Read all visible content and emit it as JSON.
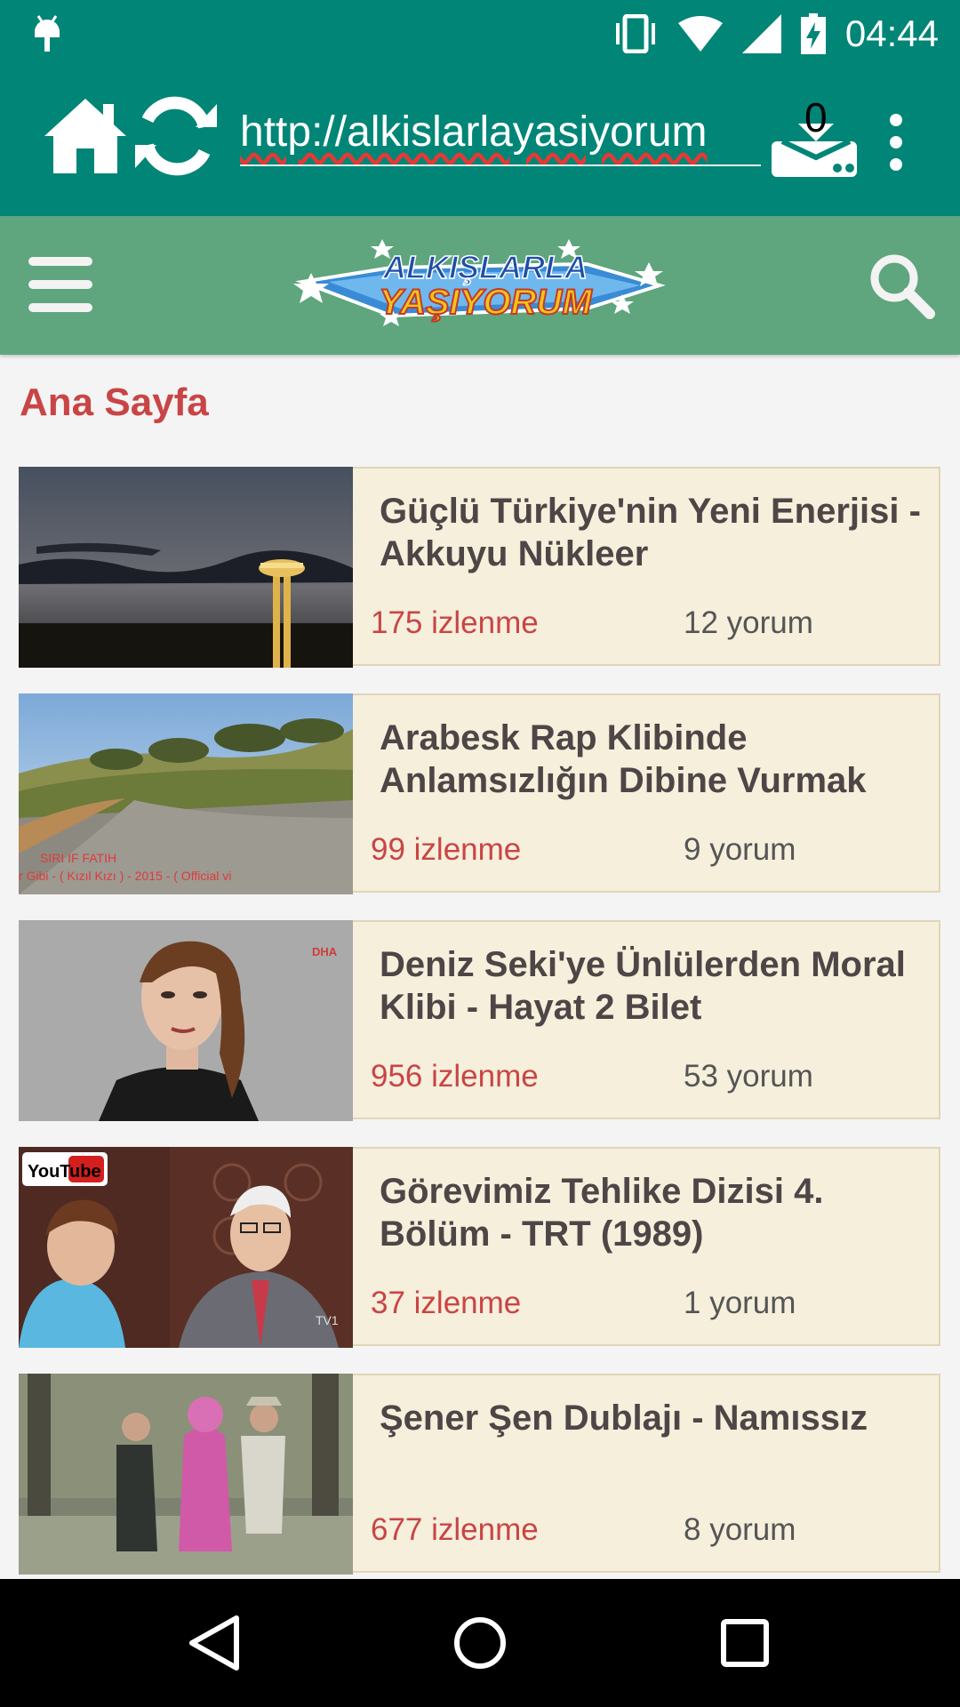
{
  "status_bar": {
    "time": "04:44",
    "icons": [
      "android-debug-icon",
      "vibrate-icon",
      "wifi-icon",
      "signal-icon",
      "battery-charging-icon"
    ]
  },
  "browser": {
    "url": "http://alkislarlayasiyorum",
    "download_count": "0",
    "icons": [
      "home-icon",
      "reload-icon",
      "download-icon",
      "overflow-menu-icon"
    ]
  },
  "site": {
    "logo_text_line1": "ALKIŞLARLA",
    "logo_text_line2": "YAŞIYORUM",
    "icons": [
      "hamburger-menu-icon",
      "search-icon"
    ]
  },
  "page": {
    "title": "Ana Sayfa"
  },
  "videos": [
    {
      "title": "Güçlü Türkiye'nin Yeni Enerjisi - Akkuyu Nükleer",
      "views": "175 izlenme",
      "comments": "12 yorum"
    },
    {
      "title": "Arabesk Rap Klibinde Anlamsızlığın Dibine Vurmak",
      "views": "99 izlenme",
      "comments": "9 yorum",
      "thumb_caption_1": "SIRI IF FATIH",
      "thumb_caption_2": "r Gibi - ( Kızıl Kızı ) - 2015 - ( Official vi"
    },
    {
      "title": "Deniz Seki'ye Ünlülerden Moral Klibi - Hayat 2 Bilet",
      "views": "956 izlenme",
      "comments": "53 yorum",
      "thumb_caption_1": "DHA"
    },
    {
      "title": "Görevimiz Tehlike Dizisi 4. Bölüm - TRT (1989)",
      "views": "37 izlenme",
      "comments": "1 yorum",
      "thumb_caption_1": "YouTube",
      "thumb_caption_2": "TV1"
    },
    {
      "title": "Şener Şen Dublajı - Namıssız",
      "views": "677 izlenme",
      "comments": "8 yorum"
    }
  ],
  "nav_bar": {
    "icons": [
      "back-icon",
      "home-circle-icon",
      "recents-icon"
    ]
  },
  "colors": {
    "status_toolbar": "#008577",
    "site_header": "#5fa57e",
    "accent_red": "#c94545",
    "card_bg": "#f5efdc",
    "card_border": "#e0d5b9"
  }
}
